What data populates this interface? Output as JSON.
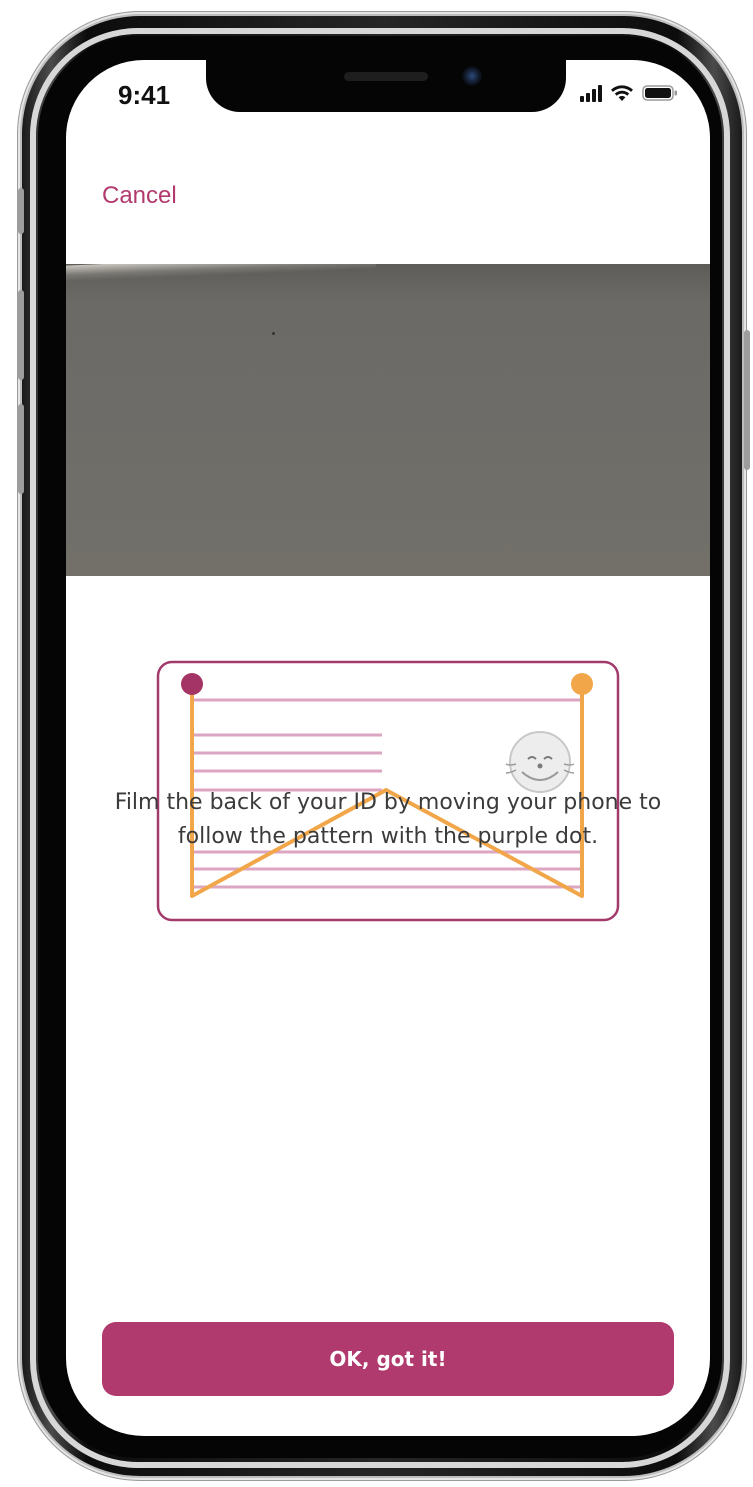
{
  "status_bar": {
    "time": "9:41",
    "signal_icon": "cellular-signal-icon",
    "wifi_icon": "wifi-icon",
    "battery_icon": "battery-icon"
  },
  "header": {
    "cancel_label": "Cancel"
  },
  "camera_preview": {
    "description_icon": "camera-feed"
  },
  "illustration": {
    "icon": "id-card-scan-pattern-icon",
    "seal_icon": "seal-face-icon",
    "colors": {
      "card_border": "#a23a6c",
      "lines": "#dca6c2",
      "path": "#f2a64a",
      "start_dot": "#a53466",
      "end_dot": "#f2a64a"
    }
  },
  "instruction": {
    "text": "Film the back of your ID by moving your phone to follow the pattern with the purple dot."
  },
  "actions": {
    "confirm_label": "OK, got it!"
  },
  "theme": {
    "accent": "#b03a6d",
    "text": "#3b3b3b"
  }
}
